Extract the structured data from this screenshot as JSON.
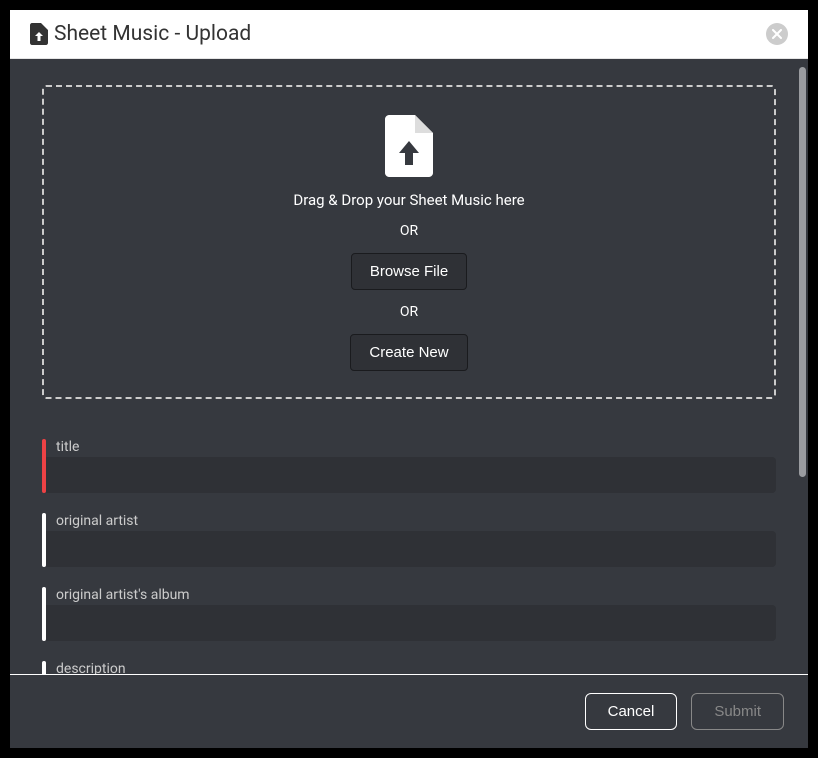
{
  "header": {
    "title": "Sheet Music - Upload"
  },
  "dropzone": {
    "drag_text": "Drag & Drop your Sheet Music here",
    "or_text_1": "OR",
    "browse_label": "Browse File",
    "or_text_2": "OR",
    "create_label": "Create New"
  },
  "form": {
    "fields": [
      {
        "label": "title",
        "required": true
      },
      {
        "label": "original artist",
        "required": false
      },
      {
        "label": "original artist's album",
        "required": false
      },
      {
        "label": "description",
        "required": false
      }
    ]
  },
  "footer": {
    "cancel_label": "Cancel",
    "submit_label": "Submit"
  }
}
